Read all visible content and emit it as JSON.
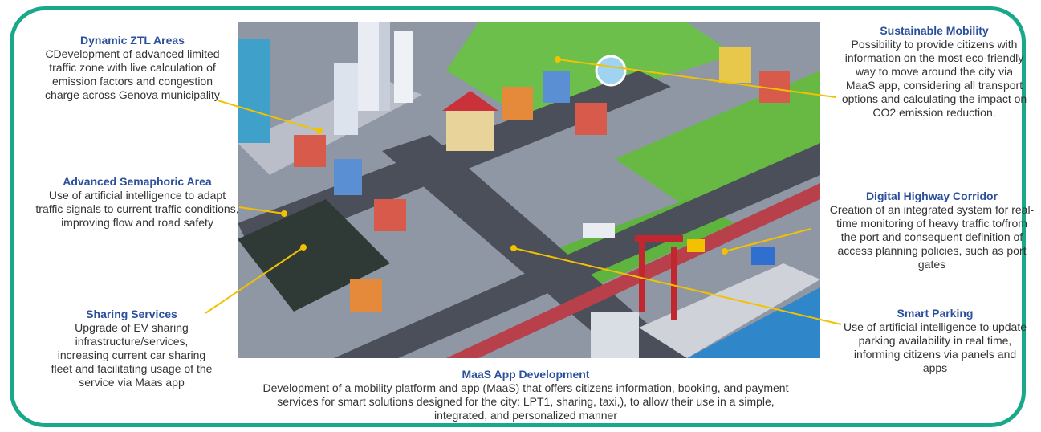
{
  "accent_color": "#1aa88a",
  "title_color": "#2b4f9b",
  "leader_color": "#f2c200",
  "illustration": {
    "name": "isometric-smart-city"
  },
  "callouts": {
    "dynamic_ztl": {
      "title": "Dynamic ZTL Areas",
      "text": "CDevelopment of advanced limited traffic zone with live calculation of emission factors and congestion charge across Genova municipality"
    },
    "semaphoric": {
      "title": "Advanced Semaphoric Area",
      "text": "Use of artificial intelligence to adapt traffic signals to current traffic conditions, improving flow and road safety"
    },
    "sharing": {
      "title": "Sharing Services",
      "text": "Upgrade of EV sharing infrastructure/services, increasing current car sharing fleet and facilitating usage of the service via Maas app"
    },
    "sustainable": {
      "title": "Sustainable Mobility",
      "text": "Possibility to provide citizens with information on the most eco-friendly way to move around the city via MaaS app, considering all transport options and calculating the impact on CO2 emission reduction."
    },
    "highway": {
      "title": "Digital Highway Corridor",
      "text": "Creation of an integrated system for real-time monitoring of heavy traffic to/from the port and consequent definition of access planning policies, such as port gates"
    },
    "parking": {
      "title": "Smart Parking",
      "text": "Use of artificial intelligence to update parking availability in real time, informing citizens via panels and apps"
    },
    "maas": {
      "title": "MaaS App Development",
      "text": "Development of a mobility platform and app (MaaS) that offers citizens information, booking, and payment services for smart solutions designed for the city: LPT1, sharing, taxi,), to allow their use in a simple, integrated, and personalized manner"
    }
  }
}
